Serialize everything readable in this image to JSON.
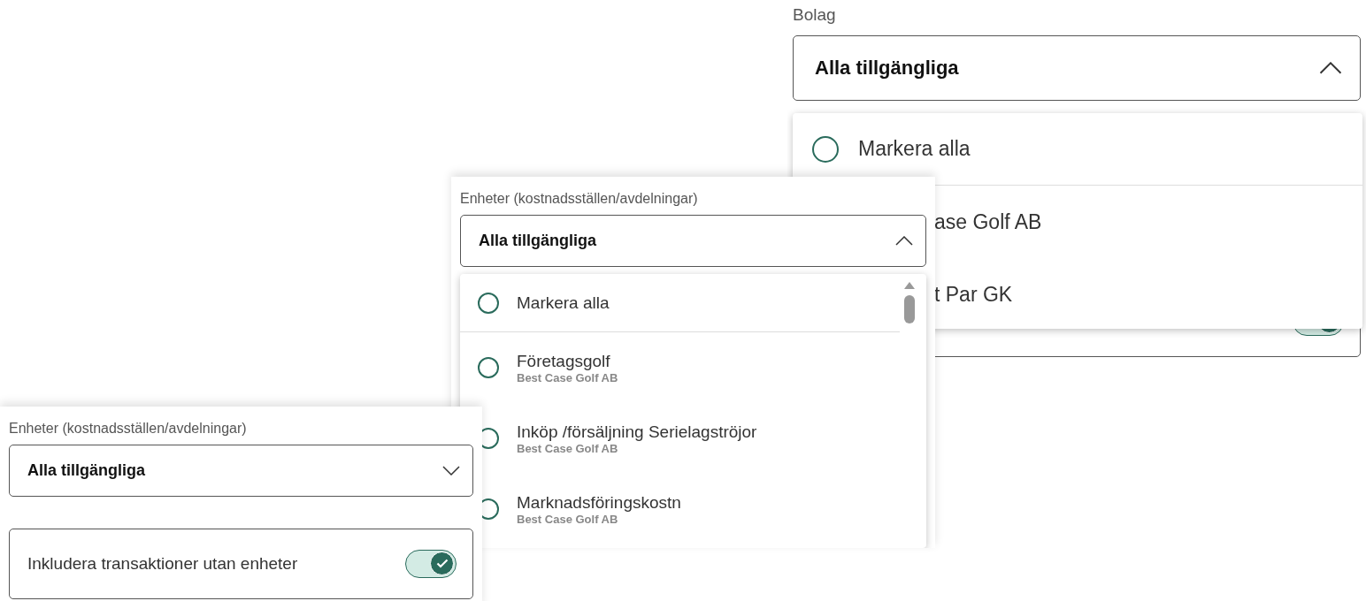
{
  "panels": [
    {
      "label": "Bolag",
      "kind": "wide",
      "select": {
        "value": "Alla tillgängliga",
        "expanded": true
      },
      "options": [
        {
          "label": "Markera alla",
          "selected": false
        },
        {
          "label": "ase Golf AB"
        },
        {
          "label": "t Par GK"
        }
      ],
      "toggle": {
        "on": true
      }
    },
    {
      "label": "Enheter (kostnadsställen/avdelningar)",
      "kind": "compact",
      "select": {
        "value": "Alla tillgängliga",
        "expanded": true
      },
      "options": [
        {
          "label": "Markera alla",
          "selected": false
        },
        {
          "label": "Företagsgolf",
          "sublabel": "Best Case Golf AB",
          "selected": false
        },
        {
          "label": "Inköp /försäljning Serielagströjor",
          "sublabel": "Best Case Golf AB",
          "selected": false
        },
        {
          "label": "Marknadsföringskostn",
          "sublabel": "Best Case Golf AB",
          "selected": false
        }
      ]
    },
    {
      "label": "Enheter (kostnadsställen/avdelningar)",
      "kind": "compact",
      "select": {
        "value": "Alla tillgängliga",
        "expanded": false
      },
      "toggle": {
        "label": "Inkludera transaktioner utan enheter",
        "on": true
      }
    }
  ]
}
